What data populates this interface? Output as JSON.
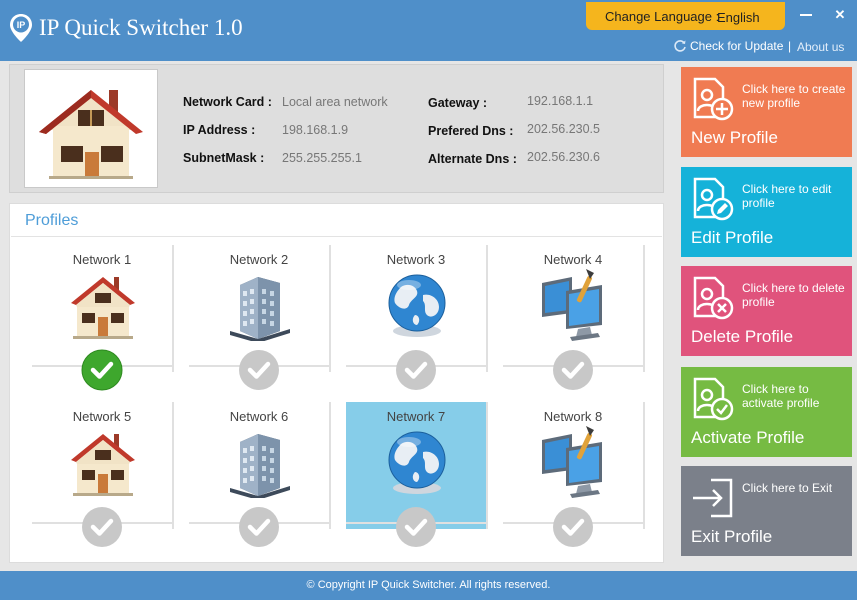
{
  "window": {
    "title": "IP Quick Switcher 1.0",
    "logo_text": "IP",
    "close_glyph": "✕"
  },
  "language": {
    "label": "Change Language :",
    "value": "English"
  },
  "links": {
    "update": "Check for Update",
    "separator": "|",
    "about": "About us"
  },
  "info": {
    "network_card_label": "Network Card :",
    "network_card_value": "Local area network",
    "ip_label": "IP Address :",
    "ip_value": "198.168.1.9",
    "subnet_label": "SubnetMask :",
    "subnet_value": "255.255.255.1",
    "gateway_label": "Gateway :",
    "gateway_value": "192.168.1.1",
    "dns_label": "Prefered Dns :",
    "dns_value": "202.56.230.5",
    "alt_dns_label": "Alternate Dns :",
    "alt_dns_value": "202.56.230.6"
  },
  "profiles": {
    "title": "Profiles",
    "items": [
      {
        "name": "Network 1",
        "icon": "house-icon",
        "status": "active"
      },
      {
        "name": "Network 2",
        "icon": "office-building-icon",
        "status": "inactive"
      },
      {
        "name": "Network 3",
        "icon": "globe-icon",
        "status": "inactive"
      },
      {
        "name": "Network 4",
        "icon": "monitors-icon",
        "status": "inactive"
      },
      {
        "name": "Network 5",
        "icon": "house-icon",
        "status": "inactive"
      },
      {
        "name": "Network 6",
        "icon": "office-building-icon",
        "status": "inactive"
      },
      {
        "name": "Network 7",
        "icon": "globe-icon",
        "status": "inactive",
        "selected": true
      },
      {
        "name": "Network 8",
        "icon": "monitors-icon",
        "status": "inactive"
      }
    ]
  },
  "actions": {
    "new": {
      "hint": "Click here to create new profile",
      "title": "New Profile",
      "color": "#f07b52"
    },
    "edit": {
      "hint": "Click here to edit profile",
      "title": "Edit Profile",
      "color": "#15b2d9"
    },
    "delete": {
      "hint": "Click here to delete profile",
      "title": "Delete Profile",
      "color": "#e0537c"
    },
    "activate": {
      "hint": "Click here to activate profile",
      "title": "Activate Profile",
      "color": "#76bb43"
    },
    "exit": {
      "hint": "Click here to Exit",
      "title": "Exit Profile",
      "color": "#7b808a"
    }
  },
  "colors": {
    "titlebar": "#4f8fc9",
    "accent": "#f5b51d",
    "active_check": "#3ea72d",
    "inactive_check": "#c8c8c8",
    "selected_tile": "#86cde9"
  },
  "footer": {
    "copyright": "© Copyright IP Quick Switcher. All rights reserved."
  }
}
